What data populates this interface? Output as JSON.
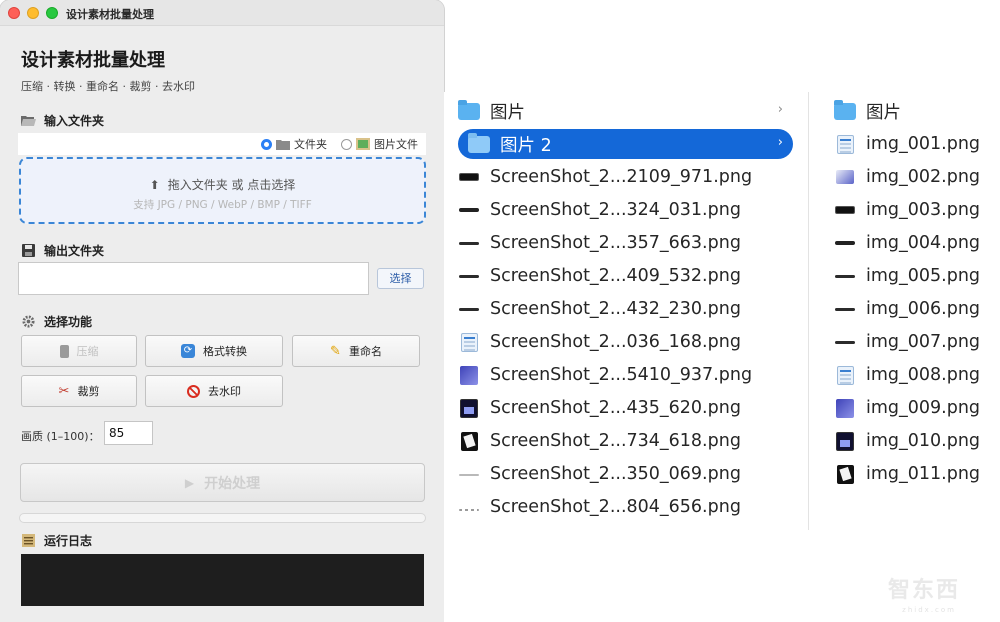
{
  "window": {
    "title": "设计素材批量处理"
  },
  "header": {
    "title": "设计素材批量处理",
    "subtitle": "压缩 · 转换 · 重命名 · 裁剪 · 去水印"
  },
  "input_section": {
    "label": "输入文件夹",
    "radio_folder": "文件夹",
    "radio_files": "图片文件",
    "selected_radio": "文件夹",
    "drop_text": "拖入文件夹 或 点击选择",
    "drop_hint": "支持 JPG / PNG / WebP / BMP / TIFF"
  },
  "output_section": {
    "label": "输出文件夹",
    "value": "",
    "choose_label": "选择"
  },
  "function_section": {
    "label": "选择功能",
    "buttons": [
      {
        "label": "压缩",
        "icon": "compress-icon",
        "enabled": false
      },
      {
        "label": "格式转换",
        "icon": "convert-icon",
        "enabled": true
      },
      {
        "label": "重命名",
        "icon": "pencil-icon",
        "enabled": true
      },
      {
        "label": "裁剪",
        "icon": "scissors-icon",
        "enabled": true
      },
      {
        "label": "去水印",
        "icon": "no-entry-icon",
        "enabled": true
      }
    ]
  },
  "quality": {
    "label": "画质 (1–100)：",
    "value": "85"
  },
  "start_button": {
    "label": "开始处理",
    "enabled": false
  },
  "progress": {
    "fraction": 0
  },
  "log_section": {
    "label": "运行日志"
  },
  "finder": {
    "col1": [
      {
        "name": "图片",
        "type": "folder",
        "selected": false
      },
      {
        "name": "图片 2",
        "type": "folder",
        "selected": true
      },
      {
        "name": "ScreenShot_2...2109_971.png",
        "type": "png",
        "thumb": "bar"
      },
      {
        "name": "ScreenShot_2...324_031.png",
        "type": "png",
        "thumb": "bar2"
      },
      {
        "name": "ScreenShot_2...357_663.png",
        "type": "png",
        "thumb": "line"
      },
      {
        "name": "ScreenShot_2...409_532.png",
        "type": "png",
        "thumb": "line"
      },
      {
        "name": "ScreenShot_2...432_230.png",
        "type": "png",
        "thumb": "line"
      },
      {
        "name": "ScreenShot_2...036_168.png",
        "type": "png",
        "thumb": "doc"
      },
      {
        "name": "ScreenShot_2...5410_937.png",
        "type": "png",
        "thumb": "blue"
      },
      {
        "name": "ScreenShot_2...435_620.png",
        "type": "png",
        "thumb": "dark"
      },
      {
        "name": "ScreenShot_2...734_618.png",
        "type": "png",
        "thumb": "card"
      },
      {
        "name": "ScreenShot_2...350_069.png",
        "type": "png",
        "thumb": "gray"
      },
      {
        "name": "ScreenShot_2...804_656.png",
        "type": "png",
        "thumb": "dots"
      }
    ],
    "col2": [
      {
        "name": "图片",
        "type": "folder"
      },
      {
        "name": "img_001.png",
        "thumb": "doc"
      },
      {
        "name": "img_002.png",
        "thumb": "wave"
      },
      {
        "name": "img_003.png",
        "thumb": "bar"
      },
      {
        "name": "img_004.png",
        "thumb": "bar2"
      },
      {
        "name": "img_005.png",
        "thumb": "line"
      },
      {
        "name": "img_006.png",
        "thumb": "line"
      },
      {
        "name": "img_007.png",
        "thumb": "line"
      },
      {
        "name": "img_008.png",
        "thumb": "doc"
      },
      {
        "name": "img_009.png",
        "thumb": "blue"
      },
      {
        "name": "img_010.png",
        "thumb": "dark"
      },
      {
        "name": "img_011.png",
        "thumb": "card"
      }
    ]
  },
  "watermark": {
    "text": "智东西",
    "sub": "zhidx.com"
  },
  "colors": {
    "accent": "#1468d8",
    "folder": "#5ab2f0",
    "dashed": "#3b86d6",
    "log_bg": "#1e1e1e"
  }
}
